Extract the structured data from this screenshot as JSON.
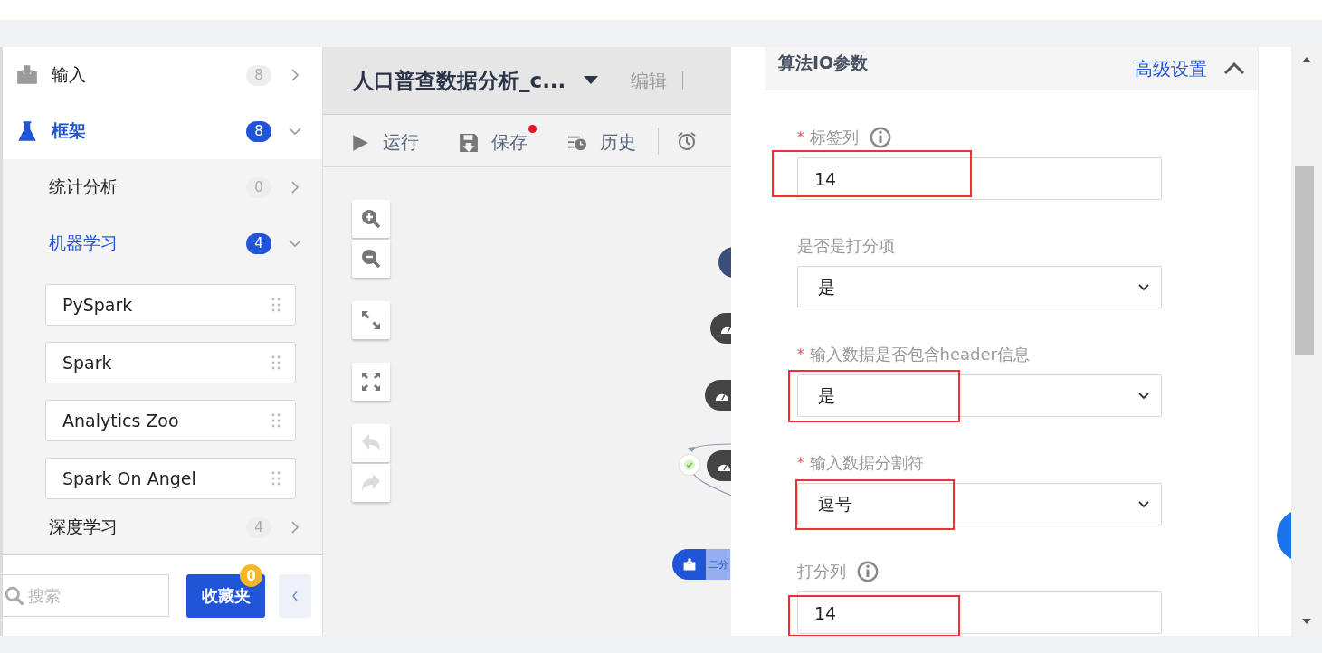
{
  "sidebar": {
    "items": [
      {
        "label": "输入",
        "count": "8",
        "expanded": false
      },
      {
        "label": "框架",
        "count": "8",
        "expanded": true,
        "children": [
          {
            "label": "统计分析",
            "count": "0",
            "expanded": false
          },
          {
            "label": "机器学习",
            "count": "4",
            "expanded": true,
            "children": [
              {
                "label": "PySpark"
              },
              {
                "label": "Spark"
              },
              {
                "label": "Analytics Zoo"
              },
              {
                "label": "Spark On Angel"
              }
            ]
          },
          {
            "label": "深度学习",
            "count": "4",
            "expanded": false
          }
        ]
      }
    ],
    "search": {
      "placeholder": "搜索"
    },
    "favorites": {
      "label": "收藏夹",
      "badge": "0"
    }
  },
  "canvas": {
    "title": "人口普查数据分析_c...",
    "edit": "编辑",
    "toolbar": [
      {
        "label": "运行",
        "dot": false
      },
      {
        "label": "保存",
        "dot": true
      },
      {
        "label": "历史",
        "dot": false
      }
    ],
    "controls": [
      {
        "disabled": false
      },
      {
        "disabled": false
      },
      {
        "disabled": false
      },
      {
        "disabled": false
      },
      {
        "disabled": true
      },
      {
        "disabled": true
      }
    ],
    "nodes": [
      {
        "kind": "circle"
      },
      {
        "kind": "pill"
      },
      {
        "kind": "pill"
      },
      {
        "kind": "check"
      },
      {
        "kind": "pill"
      },
      {
        "kind": "input",
        "label": "二分"
      }
    ]
  },
  "panel": {
    "title": "算法IO参数",
    "advanced": "高级设置",
    "expanded": true,
    "fields": [
      {
        "kind": "input",
        "mark": "*",
        "label": "标签列",
        "info": true,
        "value": "14",
        "highlighted": true
      },
      {
        "kind": "select",
        "label": "是否是打分项",
        "info": false,
        "value": "是",
        "highlighted": false
      },
      {
        "kind": "select",
        "mark": "*",
        "label": "输入数据是否包含header信息",
        "info": false,
        "value": "是",
        "highlighted": true
      },
      {
        "kind": "select",
        "mark": "*",
        "label": "输入数据分割符",
        "info": false,
        "value": "逗号",
        "highlighted": true
      },
      {
        "kind": "input",
        "label": "打分列",
        "info": true,
        "value": "14",
        "highlighted": true
      }
    ]
  }
}
